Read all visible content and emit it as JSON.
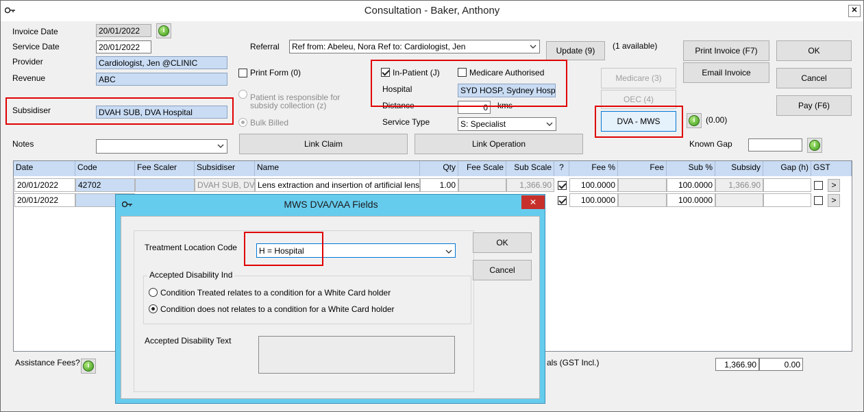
{
  "window": {
    "title": "Consultation - Baker, Anthony",
    "close_label": "✕"
  },
  "form": {
    "invoice_date_label": "Invoice Date",
    "invoice_date": "20/01/2022",
    "service_date_label": "Service Date",
    "service_date": "20/01/2022",
    "provider_label": "Provider",
    "provider": "Cardiologist, Jen @CLINIC",
    "revenue_label": "Revenue",
    "revenue": "ABC",
    "subsidiser_label": "Subsidiser",
    "subsidiser": "DVAH SUB, DVA Hospital",
    "notes_label": "Notes",
    "notes": "",
    "referral_label": "Referral",
    "referral": "Ref from: Abeleu, Nora Ref to: Cardiologist, Jen",
    "update_button": "Update (9)",
    "available_text": "(1 available)",
    "print_form_label": "Print Form (0)",
    "patient_responsible_label": "Patient is responsible for subsidy collection (z)",
    "bulk_billed_label": "Bulk Billed",
    "inpatient_label": "In-Patient (J)",
    "medicare_authorised_label": "Medicare Authorised",
    "hospital_label": "Hospital",
    "hospital": "SYD HOSP, Sydney Hospital",
    "distance_label": "Distance",
    "distance": "0",
    "kms_label": "kms",
    "service_type_label": "Service Type",
    "service_type": "S: Specialist",
    "link_claim_button": "Link Claim",
    "link_operation_button": "Link Operation",
    "known_gap_label": "Known Gap",
    "known_gap": "",
    "assistance_fees_label": "Assistance Fees?",
    "totals_label": "als (GST Incl.)",
    "total_amount": "1,366.90",
    "total_gst": "0.00"
  },
  "buttons": {
    "print_invoice": "Print Invoice (F7)",
    "ok": "OK",
    "email_invoice": "Email Invoice",
    "cancel": "Cancel",
    "pay": "Pay (F6)",
    "medicare": "Medicare (3)",
    "oec": "OEC (4)",
    "dva_mws": "DVA - MWS",
    "dva_amount": "(0.00)"
  },
  "grid": {
    "headers": [
      "Date",
      "Code",
      "Fee Scaler",
      "Subsidiser",
      "Name",
      "Qty",
      "Fee Scale",
      "Sub Scale",
      "?",
      "Fee %",
      "Fee",
      "Sub %",
      "Subsidy",
      "Gap (h)",
      "GST"
    ],
    "rows": [
      {
        "date": "20/01/2022",
        "code": "42702",
        "fee_scaler": "",
        "subsidiser": "DVAH SUB, DVA",
        "name": "Lens extraction and insertion of artificial lens",
        "qty": "1.00",
        "fee_scale": "",
        "sub_scale": "1,366.90",
        "fee_pct": "100.0000",
        "fee": "",
        "sub_pct": "100.0000",
        "subsidy": "1,366.90",
        "gap": "",
        "more": ">"
      },
      {
        "date": "20/01/2022",
        "code": "",
        "fee_pct": "100.0000",
        "sub_pct": "100.0000",
        "more": ">"
      }
    ]
  },
  "dialog": {
    "title": "MWS DVA/VAA Fields",
    "close_label": "✕",
    "treatment_location_label": "Treatment Location Code",
    "treatment_location": "H = Hospital",
    "accepted_disability_ind_label": "Accepted Disability Ind",
    "option_treated": "Condition Treated relates to a condition for a White Card holder",
    "option_not_treated": "Condition does not relates to a condition for a White Card holder",
    "accepted_disability_text_label": "Accepted Disability Text",
    "ok_button": "OK",
    "cancel_button": "Cancel"
  },
  "colors": {
    "highlight": "#e00000",
    "field_blue": "#c9dcf4",
    "dialog_frame": "#66ccee"
  }
}
